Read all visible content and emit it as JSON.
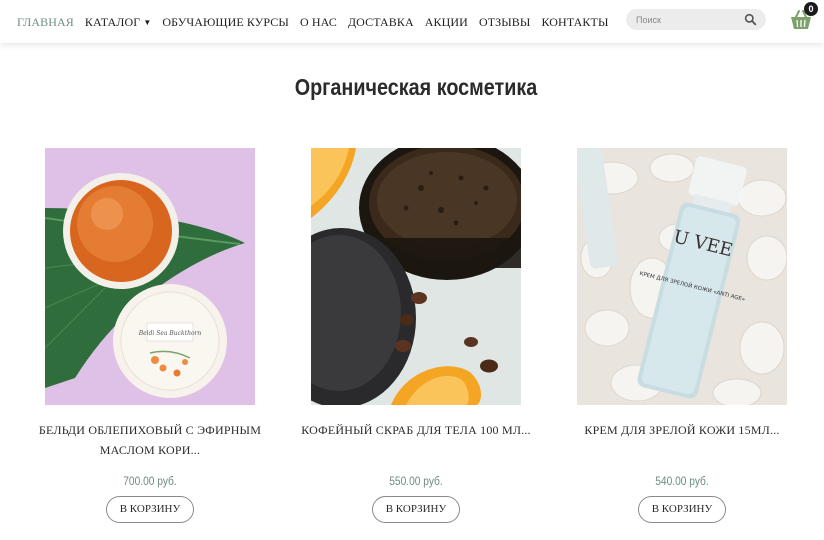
{
  "nav": {
    "items": [
      {
        "label": "ГЛАВНАЯ",
        "active": true
      },
      {
        "label": "КАТАЛОГ",
        "active": false,
        "has_dropdown": true
      },
      {
        "label": "ОБУЧАЮЩИЕ КУРСЫ",
        "active": false
      },
      {
        "label": "О НАС",
        "active": false
      },
      {
        "label": "ДОСТАВКА",
        "active": false
      },
      {
        "label": "АКЦИИ",
        "active": false
      },
      {
        "label": "ОТЗЫВЫ",
        "active": false
      },
      {
        "label": "КОНТАКТЫ",
        "active": false
      }
    ]
  },
  "search": {
    "placeholder": "Поиск",
    "icon": "search-icon"
  },
  "cart": {
    "icon": "basket-icon",
    "count": "0"
  },
  "page": {
    "title": "Органическая косметика"
  },
  "products": [
    {
      "name": "БЕЛЬДИ ОБЛЕПИХОВЫЙ С ЭФИРНЫМ МАСЛОМ КОРИ...",
      "price": "700.00 руб.",
      "button": "В КОРЗИНУ",
      "image": "jar-of-orange-gel-with-sea-buckthorn-label",
      "jar_label": "Beldi Sea Buckthorn"
    },
    {
      "name": "КОФЕЙНЫЙ СКРАБ ДЛЯ ТЕЛА 100 МЛ...",
      "price": "550.00 руб.",
      "button": "В КОРЗИНУ",
      "image": "coffee-scrub-jar-with-orange-slices"
    },
    {
      "name": "КРЕМ ДЛЯ ЗРЕЛОЙ КОЖИ 15МЛ...",
      "price": "540.00 руб.",
      "button": "В КОРЗИНУ",
      "image": "cream-bottle-on-white-stones",
      "bottle_brand": "U VEE",
      "bottle_text": "КРЕМ ДЛЯ ЗРЕЛОЙ КОЖИ «ANTI AGE»"
    }
  ],
  "colors": {
    "accent": "#6e8c85",
    "text": "#2b2b2b",
    "badge": "#1a1a1a",
    "basket": "#7ea06a"
  }
}
